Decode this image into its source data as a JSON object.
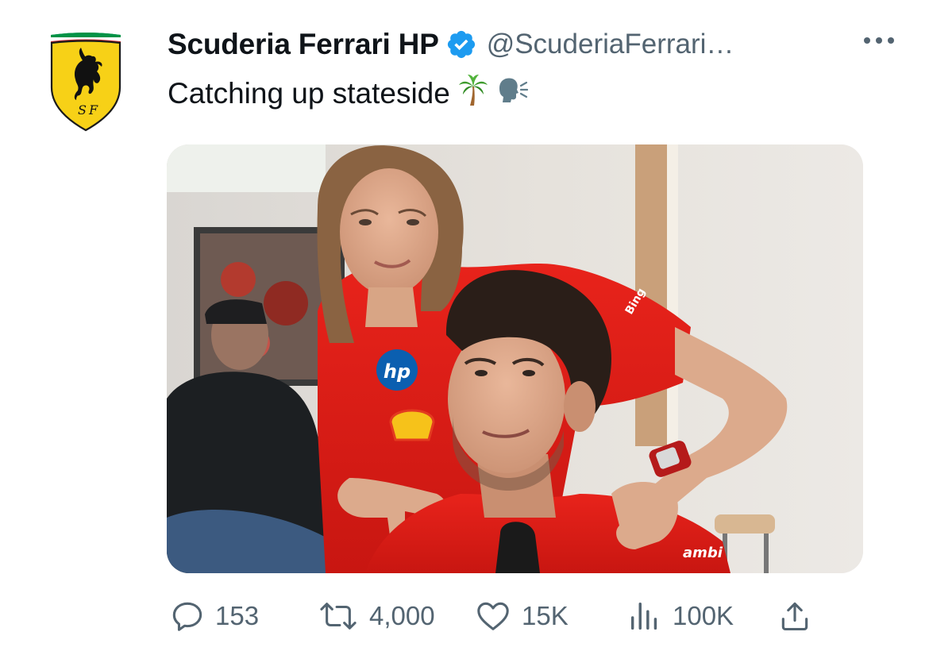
{
  "tweet": {
    "display_name": "Scuderia Ferrari HP",
    "verified": true,
    "handle": "@ScuderiaFerrari…",
    "text": "Catching up stateside",
    "text_emojis": [
      "palm-tree-emoji",
      "speaking-head-emoji"
    ],
    "media_image_texts": {
      "hp_logo": "hp",
      "ambient_text": "ambi",
      "sleeve_text": "Bing"
    }
  },
  "actions": {
    "replies": "153",
    "retweets": "4,000",
    "likes": "15K",
    "views": "100K"
  },
  "colors": {
    "text_primary": "#0f1419",
    "text_secondary": "#536471",
    "verified_blue": "#1d9bf0",
    "ferrari_yellow": "#f7d117",
    "ferrari_red": "#d40000"
  },
  "icons": [
    "ferrari-logo",
    "verified-badge-icon",
    "more-icon",
    "reply-icon",
    "retweet-icon",
    "like-icon",
    "views-icon",
    "share-icon"
  ]
}
